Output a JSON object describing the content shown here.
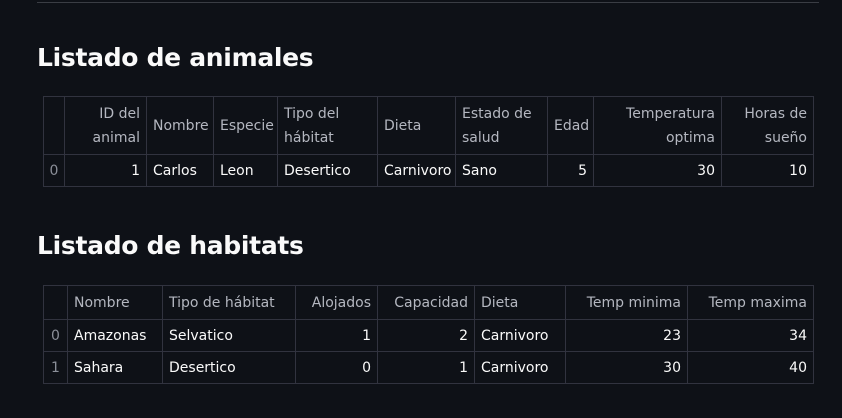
{
  "animals": {
    "title": "Listado de animales",
    "columns": [
      "ID del animal",
      "Nombre",
      "Especie",
      "Tipo del hábitat",
      "Dieta",
      "Estado de salud",
      "Edad",
      "Temperatura optima",
      "Horas de sueño"
    ],
    "rows": [
      {
        "index": "0",
        "id": "1",
        "nombre": "Carlos",
        "especie": "Leon",
        "tipo_habitat": "Desertico",
        "dieta": "Carnivoro",
        "estado_salud": "Sano",
        "edad": "5",
        "temperatura": "30",
        "horas_sueno": "10"
      }
    ]
  },
  "habitats": {
    "title": "Listado de habitats",
    "columns": [
      "Nombre",
      "Tipo de hábitat",
      "Alojados",
      "Capacidad",
      "Dieta",
      "Temp minima",
      "Temp maxima"
    ],
    "rows": [
      {
        "index": "0",
        "nombre": "Amazonas",
        "tipo": "Selvatico",
        "alojados": "1",
        "capacidad": "2",
        "dieta": "Carnivoro",
        "temp_min": "23",
        "temp_max": "34"
      },
      {
        "index": "1",
        "nombre": "Sahara",
        "tipo": "Desertico",
        "alojados": "0",
        "capacidad": "1",
        "dieta": "Carnivoro",
        "temp_min": "30",
        "temp_max": "40"
      }
    ]
  }
}
